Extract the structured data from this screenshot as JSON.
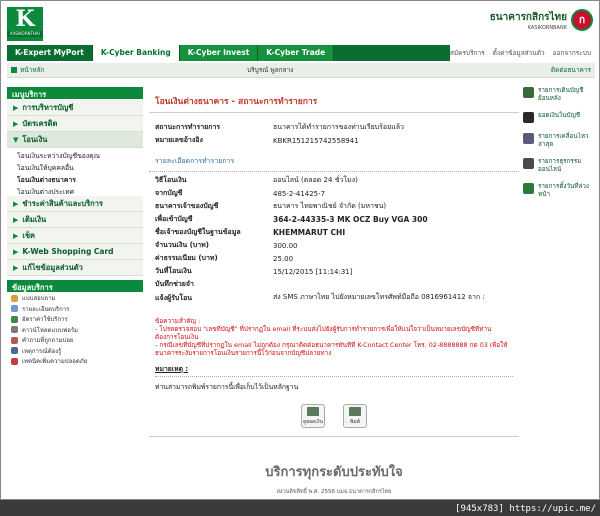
{
  "header": {
    "logo_letter": "K",
    "logo_text": "KASIKORNTHAI",
    "bank_th": "ธนาคารกสิกรไทย",
    "bank_en": "KASIKORNBANK",
    "seal_letter": "ก"
  },
  "nav": {
    "tabs": [
      {
        "label": "K-Expert MyPort",
        "style": "dark"
      },
      {
        "label": "K-Cyber Banking",
        "style": "active"
      },
      {
        "label": "K-Cyber Invest",
        "style": "green"
      },
      {
        "label": "K-Cyber Trade",
        "style": "green"
      }
    ],
    "links": [
      "สมัครบริการ",
      "ตั้งค่าข้อมูลส่วนตัว",
      "ออกจากระบบ"
    ]
  },
  "subbar": {
    "home": "หน้าหลัก",
    "service": "บริบูรณ์ พูลกลาง",
    "contact": "ติดต่อธนาคาร"
  },
  "sidebar": {
    "menu_title": "เมนูบริการ",
    "items": [
      "การบริหารบัญชี",
      "บัตรเครดิต",
      "โอนเงิน"
    ],
    "subitems": [
      "โอนเงินระหว่างบัญชีของคุณ",
      "โอนเงินให้บุคคลอื่น",
      "โอนเงินต่างธนาคาร",
      "โอนเงินต่างประเทศ"
    ],
    "items2": [
      "ชำระค่าสินค้าและบริการ",
      "เติมเงิน",
      "เช็ค",
      "K-Web Shopping Card",
      "แก้ไขข้อมูลส่วนตัว"
    ],
    "help_title": "ข้อมูลบริการ",
    "help": [
      {
        "label": "แบบสอบถาม",
        "color": "#d9a13a"
      },
      {
        "label": "รายละเอียดบริการ",
        "color": "#6a9ad0"
      },
      {
        "label": "อัตราค่าใช้บริการ",
        "color": "#3a8a4a"
      },
      {
        "label": "ดาวน์โหลดแบบฟอร์ม",
        "color": "#7a7a7a"
      },
      {
        "label": "คำถามที่ถูกถามบ่อย",
        "color": "#b05a5a"
      },
      {
        "label": "เหตุการณ์ต้องรู้",
        "color": "#4a6a9a"
      },
      {
        "label": "เทคนิคเพิ่มความปลอดภัย",
        "color": "#c04040"
      }
    ]
  },
  "main": {
    "title": "โอนเงินต่างธนาคาร - สถานะการทำรายการ",
    "top_rows": [
      {
        "label": "สถานะการทำรายการ",
        "value": "ธนาคารได้ทำรายการของท่านเรียบร้อยแล้ว"
      },
      {
        "label": "หมายเลขอ้างอิง",
        "value": "KBKR151215742558941"
      }
    ],
    "section": "รายละเอียดการทำรายการ",
    "rows": [
      {
        "label": "วิธีโอนเงิน",
        "value": "ออนไลน์ (ตลอด 24 ชั่วโมง)",
        "bold": false
      },
      {
        "label": "จากบัญชี",
        "value": "485-2-41425-7",
        "bold": false
      },
      {
        "label": "ธนาคารเจ้าของบัญชี",
        "value": "ธนาคาร ไทยพาณิชย์ จำกัด (มหาชน)",
        "bold": false
      },
      {
        "label": "เพื่อเข้าบัญชี",
        "value": "364-2-44335-3 MK OCZ Buy VGA 300",
        "bold": true
      },
      {
        "label": "ชื่อเจ้าของบัญชีในฐานข้อมูล",
        "value": "KHEMMARUT CHI",
        "bold": true
      },
      {
        "label": "จำนวนเงิน (บาท)",
        "value": "300.00",
        "bold": false
      },
      {
        "label": "ค่าธรรมเนียม (บาท)",
        "value": "25.00",
        "bold": false
      },
      {
        "label": "วันที่โอนเงิน",
        "value": "15/12/2015 [11:14:31]",
        "bold": false
      },
      {
        "label": "บันทึกช่วยจำ",
        "value": "",
        "bold": false
      }
    ],
    "notify_label": "แจ้งผู้รับโอน",
    "notify_value": "ส่ง SMS ภาษาไทย ไปยังหมายเลขโทรศัพท์มือถือ 0816961412 จาก :",
    "warn_title": "ข้อความสำคัญ :",
    "warn1": "- โปรดตรวจสอบ \"เลขที่บัญชี\" ที่ปรากฏใน email ที่ระบบส่งไปยังผู้รับการทำรายการเพื่อให้แน่ใจว่าเป็นหมายเลขบัญชีที่ท่านต้องการโอนเงิน",
    "warn2": "- กรณีเลขที่บัญชีที่ปรากฏใน email ไม่ถูกต้อง กรุณาติดต่อธนาคารทันทีที่ K-Contact Center โทร. 02-8888888 กด 03 เพื่อให้ธนาคารระงับรายการโอนเงินรายการนี้ไว้ก่อนจากบัญชีปลายทาง",
    "note_title": "หมายเหตุ :",
    "note": "ท่านสามารถพิมพ์รายการนี้เพื่อเก็บไว้เป็นหลักฐาน",
    "buttons": [
      "ดูยอดเงิน",
      "พิมพ์"
    ]
  },
  "right": [
    {
      "label": "รายการเดินบัญชีย้อนหลัง",
      "color": "#3a6a3a"
    },
    {
      "label": "ยอดเงินในบัญชี",
      "color": "#2a2a2a"
    },
    {
      "label": "รายการเคลื่อนไหวล่าสุด",
      "color": "#5a5a7a"
    },
    {
      "label": "รายการธุรกรรมออนไลน์",
      "color": "#4a4a4a"
    },
    {
      "label": "รายการตั้งวันที่ล่วงหน้า",
      "color": "#2a7a3a"
    }
  ],
  "footer": {
    "slogan": "บริการทุกระดับประทับใจ",
    "copyright": "สงวนลิขสิทธิ์ พ.ศ. 2556 บมจ.ธนาคารกสิกรไทย"
  },
  "watermark": "[945x783] https://upic.me/"
}
